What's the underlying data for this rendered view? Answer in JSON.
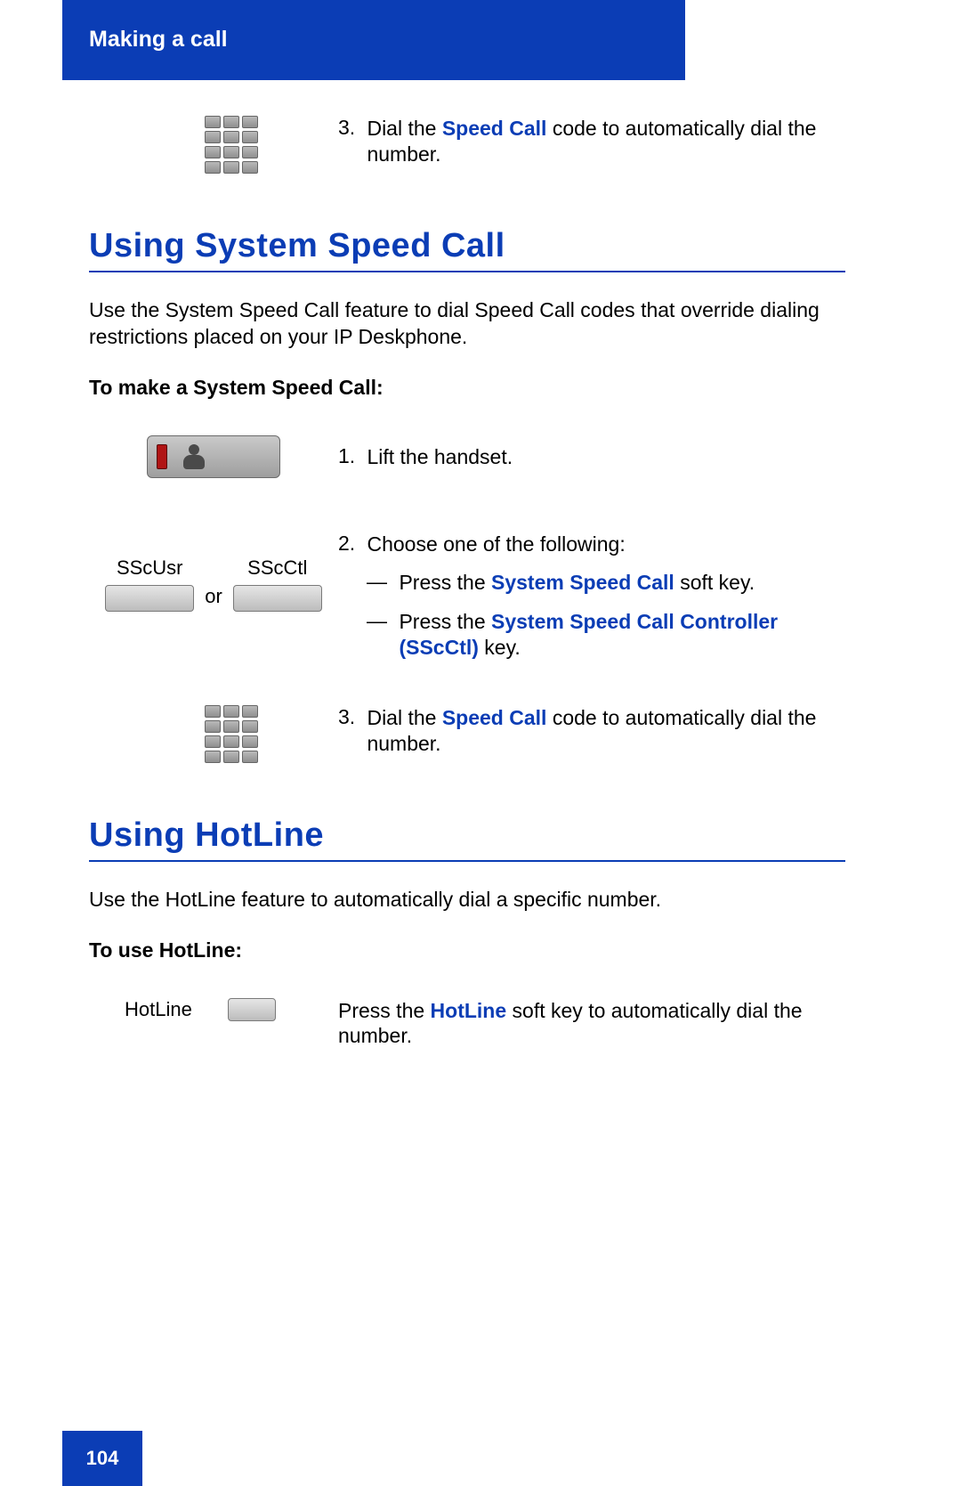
{
  "header": {
    "title": "Making a call"
  },
  "step_top": {
    "num": "3.",
    "t1": "Dial the ",
    "em": "Speed Call",
    "t2": " code to automatically dial the number."
  },
  "section1": {
    "heading": "Using System Speed Call",
    "intro": "Use the System Speed Call feature to dial Speed Call codes that override dialing restrictions placed on your IP Deskphone.",
    "lead": "To make a System Speed Call:",
    "step1": {
      "num": "1.",
      "text": "Lift the handset."
    },
    "labels": {
      "sscusr": "SScUsr",
      "sscctl": "SScCtl",
      "or": "or"
    },
    "step2": {
      "num": "2.",
      "intro": "Choose one of the following:",
      "opt1_t1": "Press the ",
      "opt1_em": "System Speed Call",
      "opt1_t2": " soft key.",
      "opt2_t1": "Press the ",
      "opt2_em": "System Speed Call Controller (SScCtl)",
      "opt2_t2": " key."
    },
    "step3": {
      "num": "3.",
      "t1": "Dial the ",
      "em": "Speed Call",
      "t2": " code to automatically dial the number."
    }
  },
  "section2": {
    "heading": "Using HotLine",
    "intro": "Use the HotLine feature to automatically dial a specific number.",
    "lead": "To use HotLine:",
    "label": "HotLine",
    "step": {
      "t1": "Press the ",
      "em": "HotLine",
      "t2": " soft key to automatically dial the number."
    }
  },
  "footer": {
    "page": "104"
  }
}
